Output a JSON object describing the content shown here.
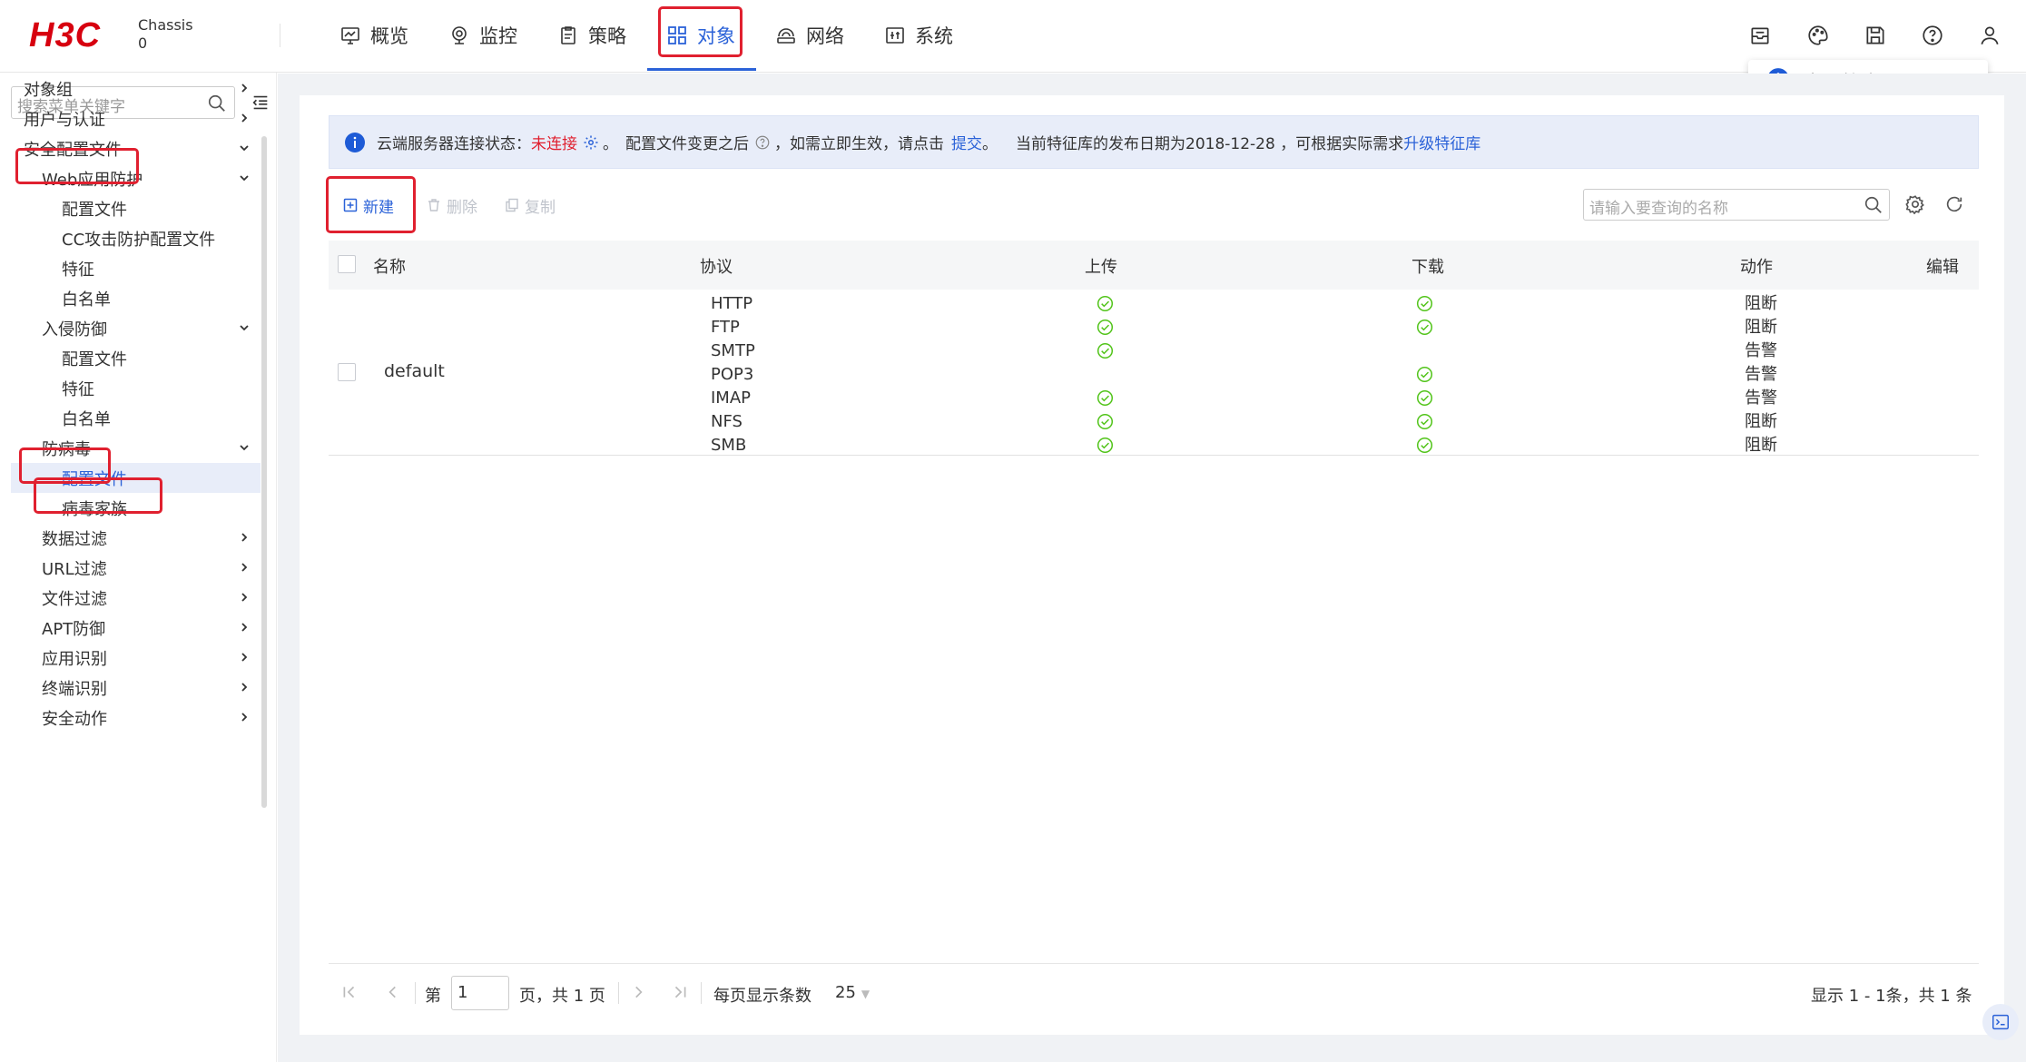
{
  "brand": {
    "logo": "H3C",
    "device_line1": "Chassis",
    "device_line2": "0"
  },
  "nav": [
    {
      "label": "概览",
      "icon": "overview-icon"
    },
    {
      "label": "监控",
      "icon": "monitor-icon"
    },
    {
      "label": "策略",
      "icon": "policy-icon"
    },
    {
      "label": "对象",
      "icon": "object-grid-icon",
      "active": true
    },
    {
      "label": "网络",
      "icon": "network-icon"
    },
    {
      "label": "系统",
      "icon": "system-icon"
    }
  ],
  "top_icons": [
    "message-box-icon",
    "palette-icon",
    "save-icon",
    "help-icon",
    "user-icon"
  ],
  "toast": {
    "text": "请及时保存配置"
  },
  "sidebar": {
    "search_placeholder": "搜索菜单关键字",
    "items": [
      {
        "label": "对象组",
        "level": 0,
        "chevron": "right"
      },
      {
        "label": "用户与认证",
        "level": 0,
        "chevron": "right"
      },
      {
        "label": "安全配置文件",
        "level": 0,
        "chevron": "down",
        "highlight": true
      },
      {
        "label": "Web应用防护",
        "level": 1,
        "chevron": "down"
      },
      {
        "label": "配置文件",
        "level": 2
      },
      {
        "label": "CC攻击防护配置文件",
        "level": 2
      },
      {
        "label": "特征",
        "level": 2
      },
      {
        "label": "白名单",
        "level": 2
      },
      {
        "label": "入侵防御",
        "level": 1,
        "chevron": "down"
      },
      {
        "label": "配置文件",
        "level": 2
      },
      {
        "label": "特征",
        "level": 2
      },
      {
        "label": "白名单",
        "level": 2
      },
      {
        "label": "防病毒",
        "level": 1,
        "chevron": "down",
        "highlight": true
      },
      {
        "label": "配置文件",
        "level": 2,
        "selected": true,
        "highlight": true
      },
      {
        "label": "病毒家族",
        "level": 2
      },
      {
        "label": "数据过滤",
        "level": 1,
        "chevron": "right"
      },
      {
        "label": "URL过滤",
        "level": 1,
        "chevron": "right"
      },
      {
        "label": "文件过滤",
        "level": 1,
        "chevron": "right"
      },
      {
        "label": "APT防御",
        "level": 1,
        "chevron": "right"
      },
      {
        "label": "应用识别",
        "level": 1,
        "chevron": "right"
      },
      {
        "label": "终端识别",
        "level": 1,
        "chevron": "right"
      },
      {
        "label": "安全动作",
        "level": 1,
        "chevron": "right"
      }
    ]
  },
  "info_bar": {
    "label1": "云端服务器连接状态：",
    "status": "未连接",
    "sep1": "。",
    "label2": "配置文件变更之后",
    "label3": "，如需立即生效，请点击",
    "submit_link": "提交",
    "sep2": "。",
    "label4": "当前特征库的发布日期为2018-12-28 ，可根据实际需求",
    "upgrade_link": "升级特征库"
  },
  "toolbar": {
    "new": "新建",
    "delete": "删除",
    "copy": "复制",
    "search_placeholder": "请输入要查询的名称"
  },
  "table": {
    "headers": {
      "name": "名称",
      "protocol": "协议",
      "upload": "上传",
      "download": "下载",
      "action": "动作",
      "edit": "编辑"
    },
    "rows": [
      {
        "name": "default",
        "protocols": [
          {
            "protocol": "HTTP",
            "upload": true,
            "download": true,
            "action": "阻断"
          },
          {
            "protocol": "FTP",
            "upload": true,
            "download": true,
            "action": "阻断"
          },
          {
            "protocol": "SMTP",
            "upload": true,
            "download": false,
            "action": "告警"
          },
          {
            "protocol": "POP3",
            "upload": false,
            "download": true,
            "action": "告警"
          },
          {
            "protocol": "IMAP",
            "upload": true,
            "download": true,
            "action": "告警"
          },
          {
            "protocol": "NFS",
            "upload": true,
            "download": true,
            "action": "阻断"
          },
          {
            "protocol": "SMB",
            "upload": true,
            "download": true,
            "action": "阻断"
          }
        ]
      }
    ]
  },
  "pager": {
    "page_prefix": "第",
    "page_value": "1",
    "page_suffix": "页，共 1 页",
    "per_page_label": "每页显示条数",
    "per_page_value": "25",
    "summary": "显示 1 - 1条，共 1 条"
  },
  "colors": {
    "accent": "#2b62d8",
    "highlight": "#e0202f",
    "brand": "#d7000f",
    "ok_green": "#52c41a",
    "info_blue": "#1e5bd6"
  }
}
